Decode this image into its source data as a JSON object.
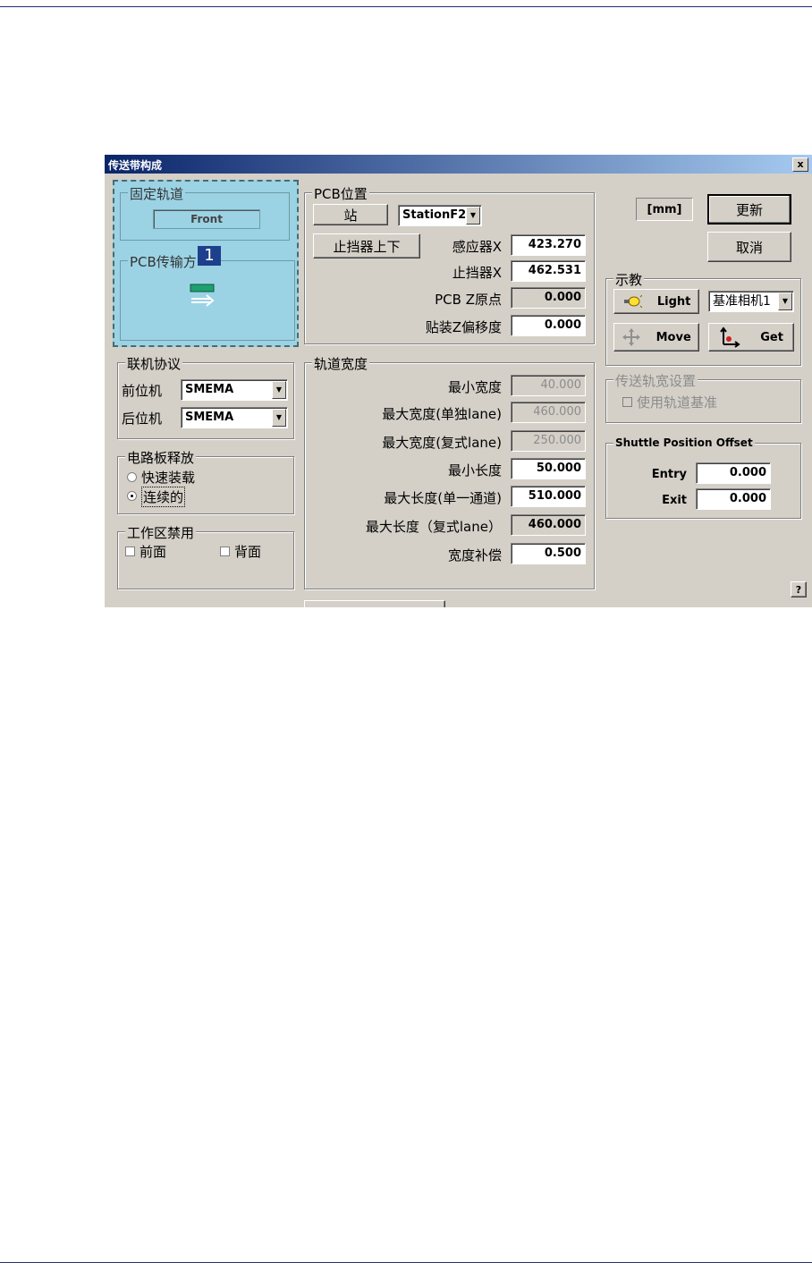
{
  "window": {
    "title": "传送带构成",
    "close_label": "x",
    "help_label": "?"
  },
  "fixed_rail": {
    "legend": "固定轨道",
    "value": "Front"
  },
  "pcb_transfer": {
    "legend": "PCB传输方",
    "badge": "1"
  },
  "link_protocol": {
    "legend": "联机协议",
    "front_label": "前位机",
    "front_value": "SMEMA",
    "rear_label": "后位机",
    "rear_value": "SMEMA"
  },
  "board_release": {
    "legend": "电路板释放",
    "option1": "快速装载",
    "option2": "连续的",
    "selected": "option2"
  },
  "work_area_disable": {
    "legend": "工作区禁用",
    "front": "前面",
    "back": "背面"
  },
  "pcb_position": {
    "legend": "PCB位置",
    "station_label": "站",
    "station_value": "StationF2",
    "stopper_button": "止挡器上下",
    "sensor_x_label": "感应器X",
    "sensor_x": "423.270",
    "stopper_x_label": "止挡器X",
    "stopper_x": "462.531",
    "pcb_z_label": "PCB Z原点",
    "pcb_z": "0.000",
    "mount_z_label": "贴装Z偏移度",
    "mount_z": "0.000"
  },
  "rail_width": {
    "legend": "轨道宽度",
    "rows": [
      {
        "label": "最小宽度",
        "value": "40.000",
        "state": "disabled"
      },
      {
        "label": "最大宽度(单独lane)",
        "value": "460.000",
        "state": "disabled"
      },
      {
        "label": "最大宽度(复式lane)",
        "value": "250.000",
        "state": "disabled"
      },
      {
        "label": "最小长度",
        "value": "50.000",
        "state": "edit"
      },
      {
        "label": "最大长度(单一通道)",
        "value": "510.000",
        "state": "edit"
      },
      {
        "label": "最大长度（复式lane）",
        "value": "460.000",
        "state": "readonly"
      },
      {
        "label": "宽度补偿",
        "value": "0.500",
        "state": "edit"
      }
    ]
  },
  "units": "[mm]",
  "buttons": {
    "update": "更新",
    "cancel": "取消"
  },
  "teach": {
    "legend": "示教",
    "light": "Light",
    "camera": "基准相机1",
    "move": "Move",
    "get": "Get"
  },
  "rail_setting": {
    "legend": "传送轨宽设置",
    "use_rail_ref": "使用轨道基准"
  },
  "shuttle": {
    "legend": "Shuttle Position Offset",
    "entry_label": "Entry",
    "entry": "0.000",
    "exit_label": "Exit",
    "exit": "0.000"
  },
  "colors": {
    "title_start": "#0a246a",
    "title_end": "#a6caf0",
    "highlight": "#9bd3e4",
    "badge": "#1d3f8c",
    "rule": "#1e2f6e"
  }
}
